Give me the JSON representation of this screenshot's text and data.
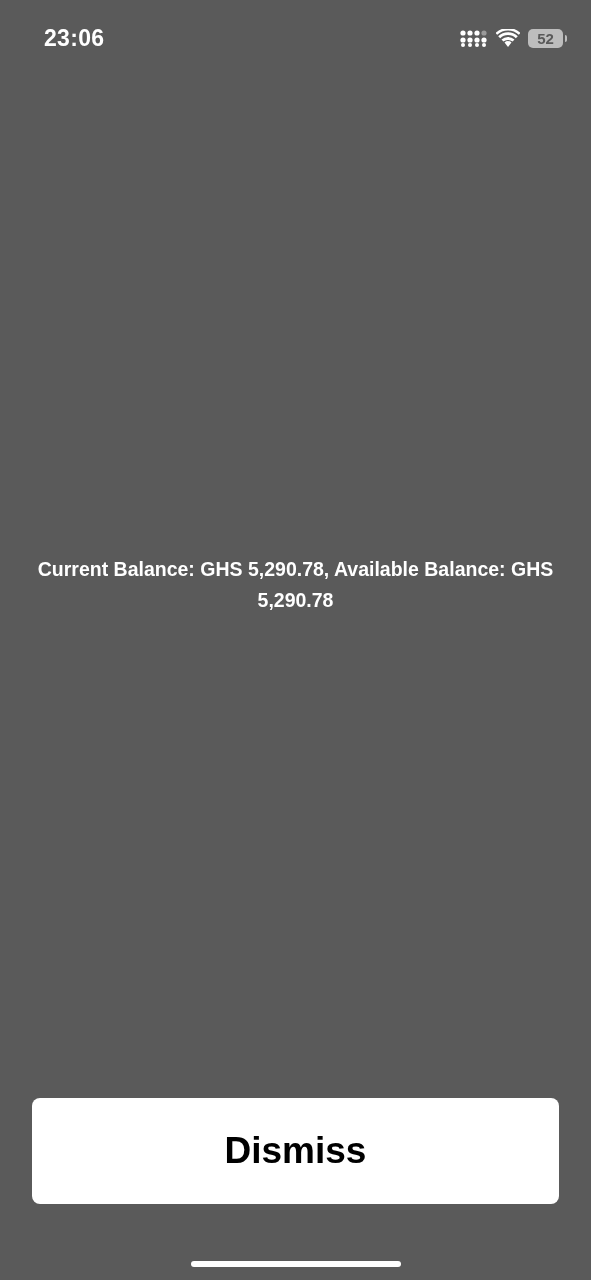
{
  "status_bar": {
    "time": "23:06",
    "battery": "52"
  },
  "message": "Current Balance: GHS 5,290.78, Available Balance: GHS 5,290.78",
  "dismiss_button": {
    "label": "Dismiss"
  }
}
